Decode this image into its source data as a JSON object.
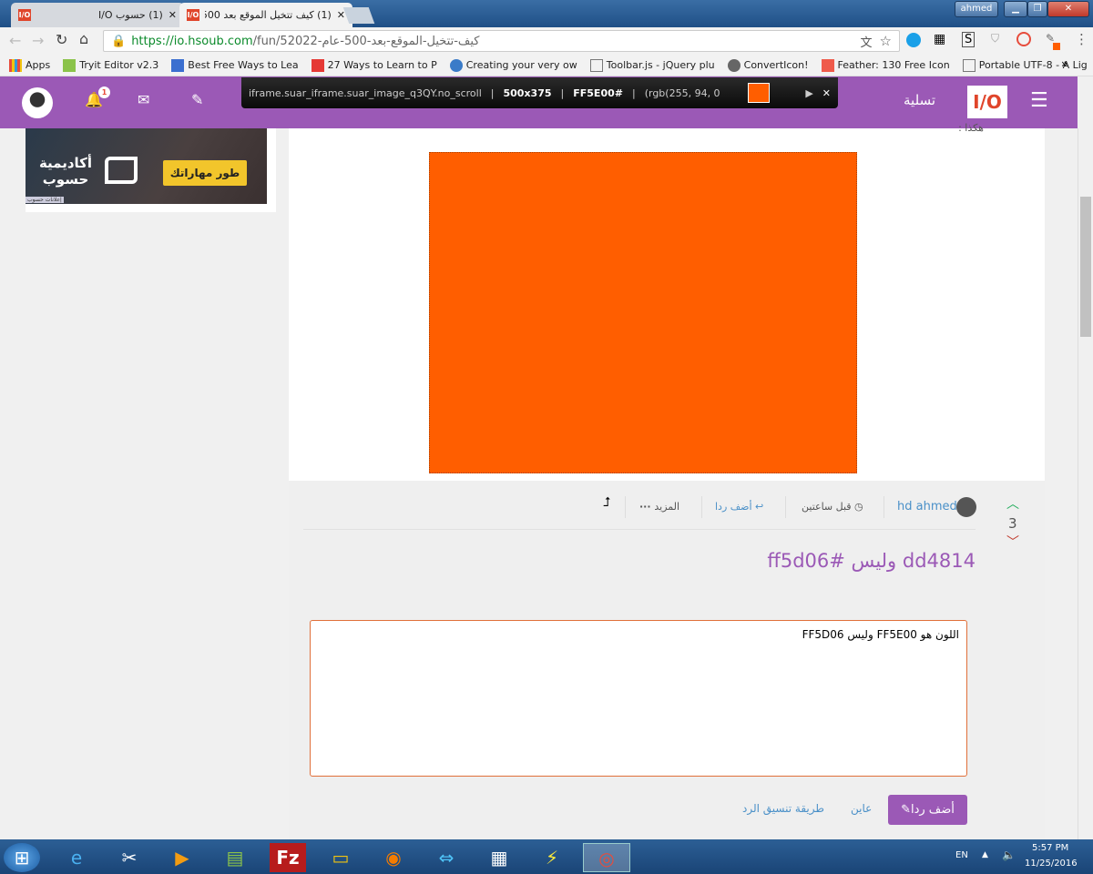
{
  "browser": {
    "tabs": [
      {
        "label": "(1) حسوب I/O"
      },
      {
        "label": "(1) كيف تتخيل الموقع بعد 500 ..."
      }
    ],
    "user": "ahmed",
    "url_host": "https://io.hsoub.com",
    "url_path": "/fun/52022-كيف-تتخيل-الموقع-بعد-500-عام",
    "bookmarks": [
      "Apps",
      "Tryit Editor v2.3",
      "Best Free Ways to Lea",
      "27 Ways to Learn to P",
      "Creating your very ow",
      "Toolbar.js - jQuery plu",
      "ConvertIcon!",
      "Feather: 130 Free Icon",
      "Portable UTF-8 - A Lig"
    ],
    "more": "»"
  },
  "header": {
    "notif_count": "1",
    "section": "تسلية",
    "logo": "I/O"
  },
  "inspector": {
    "selector": "iframe.suar_iframe.suar_image_q3QY.no_scroll",
    "size": "500x375",
    "hex": "FF5E00#",
    "rgb": "(rgb(255, 94, 0",
    "swatch": "#FF5E00"
  },
  "ad": {
    "brand": "أكاديمية حسوب",
    "button": "طور مهاراتك",
    "tag": "إعلانات حسوب"
  },
  "post": {
    "above_text": "هكذا :",
    "image_color": "#FF5E00",
    "author": "hd ahmed",
    "time": "قبل ساعتين",
    "reply": "أضف ردا",
    "more": "المزيد",
    "votes": "3",
    "title": "dd4814 وليس #ff5d06"
  },
  "reply_form": {
    "value": "اللون هو FF5E00 وليس FF5D06",
    "submit": "أضف ردا",
    "preview": "عاين",
    "format_help": "طريقة تنسيق الرد"
  },
  "taskbar": {
    "lang": "EN",
    "time": "5:57 PM",
    "date": "11/25/2016"
  }
}
